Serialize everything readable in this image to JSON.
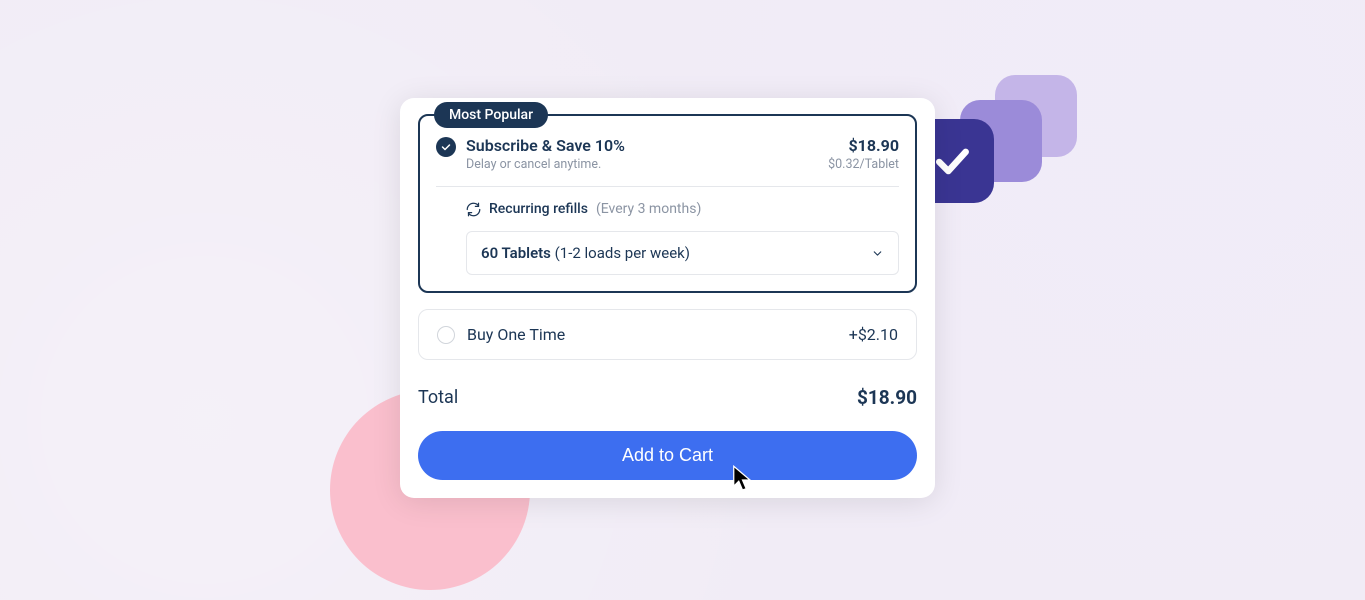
{
  "badge": "Most Popular",
  "subscribe": {
    "title": "Subscribe & Save 10%",
    "subtitle": "Delay or cancel anytime.",
    "price": "$18.90",
    "price_per_unit": "$0.32/Tablet"
  },
  "refills": {
    "label": "Recurring refills",
    "hint": "(Every 3 months)"
  },
  "quantity": {
    "value": "60 Tablets",
    "hint": "(1-2 loads per week)"
  },
  "onetime": {
    "label": "Buy One Time",
    "price": "+$2.10"
  },
  "total": {
    "label": "Total",
    "value": "$18.90"
  },
  "cta": "Add to Cart"
}
